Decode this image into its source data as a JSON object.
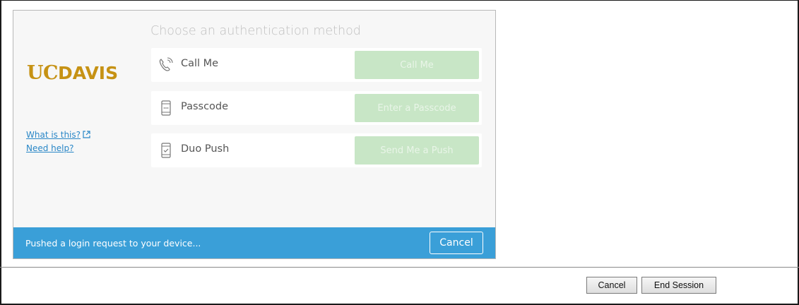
{
  "duo": {
    "logo_uc": "UC",
    "logo_davis": "DAVIS",
    "links": {
      "what_is_this": "What is this?",
      "need_help": "Need help?"
    },
    "title": "Choose an authentication method",
    "methods": [
      {
        "icon": "phone-icon",
        "label": "Call Me",
        "button": "Call Me"
      },
      {
        "icon": "passcode-device-icon",
        "label": "Passcode",
        "button": "Enter a Passcode"
      },
      {
        "icon": "push-device-icon",
        "label": "Duo Push",
        "button": "Send Me a Push"
      }
    ],
    "status": {
      "message": "Pushed a login request to your device...",
      "cancel_label": "Cancel"
    }
  },
  "footer": {
    "cancel_label": "Cancel",
    "end_session_label": "End Session"
  },
  "colors": {
    "brand_gold": "#c69214",
    "link_blue": "#2a87c7",
    "status_blue": "#3a9fd8",
    "method_button_green": "#c8e6c6"
  }
}
